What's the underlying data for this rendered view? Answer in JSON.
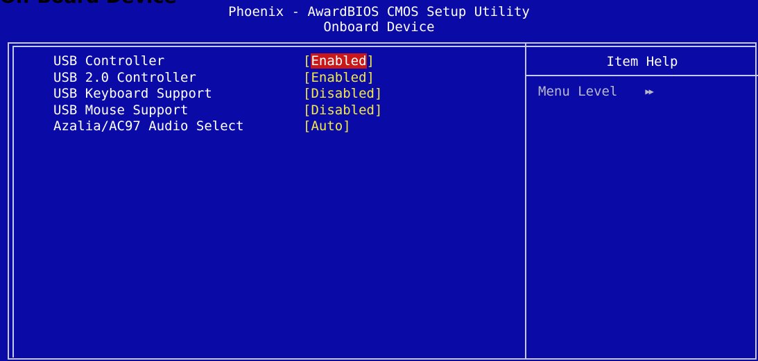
{
  "document": {
    "heading": "On-Board Device"
  },
  "bios": {
    "title": "Phoenix - AwardBIOS CMOS Setup Utility",
    "subtitle": "Onboard Device",
    "settings": [
      {
        "label": "USB Controller",
        "value": "Enabled",
        "selected": true
      },
      {
        "label": "USB 2.0 Controller",
        "value": "Enabled",
        "selected": false
      },
      {
        "label": "USB Keyboard Support",
        "value": "Disabled",
        "selected": false
      },
      {
        "label": "USB Mouse Support",
        "value": "Disabled",
        "selected": false
      },
      {
        "label": "Azalia/AC97 Audio Select",
        "value": "Auto",
        "selected": false
      }
    ],
    "help": {
      "title": "Item Help",
      "menu_level_label": "Menu Level",
      "menu_level_indicator": "▶▶"
    }
  },
  "colors": {
    "background": "#0a0aa6",
    "label_text": "#ffffff",
    "value_text": "#f2e84a",
    "highlight": "#c81818",
    "frame": "#c8c8e8"
  }
}
